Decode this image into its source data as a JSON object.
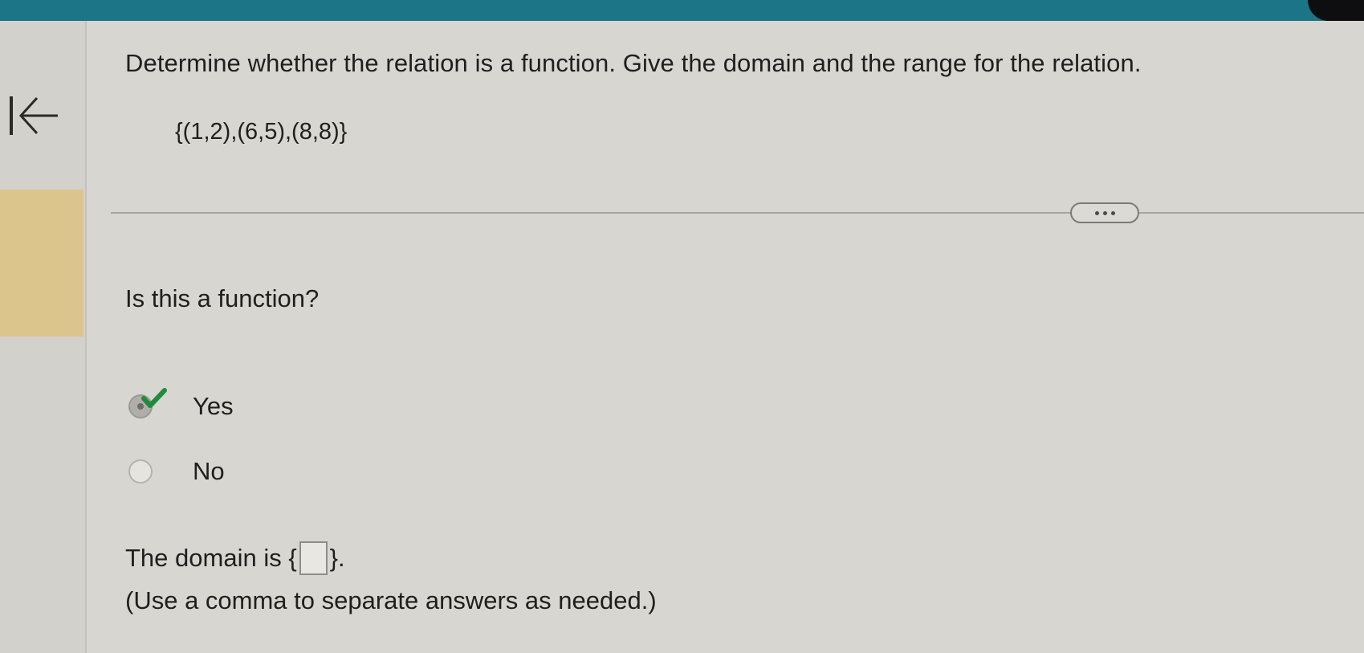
{
  "question": {
    "instruction": "Determine whether the relation is a function. Give the domain and the range for the relation.",
    "relation": "{(1,2),(6,5),(8,8)}"
  },
  "part1": {
    "prompt": "Is this a function?",
    "options": [
      {
        "label": "Yes",
        "selected": true,
        "correct": true
      },
      {
        "label": "No",
        "selected": false
      }
    ]
  },
  "part2": {
    "domain_prefix": "The domain is {",
    "domain_suffix": "}.",
    "domain_value": "",
    "hint": "(Use a comma to separate answers as needed.)"
  },
  "icons": {
    "back": "back-arrow-icon",
    "more": "ellipsis-icon",
    "check": "checkmark-icon"
  },
  "colors": {
    "top_bar": "#1c7487",
    "highlight": "#dcc48d",
    "check": "#1f8b3b"
  }
}
